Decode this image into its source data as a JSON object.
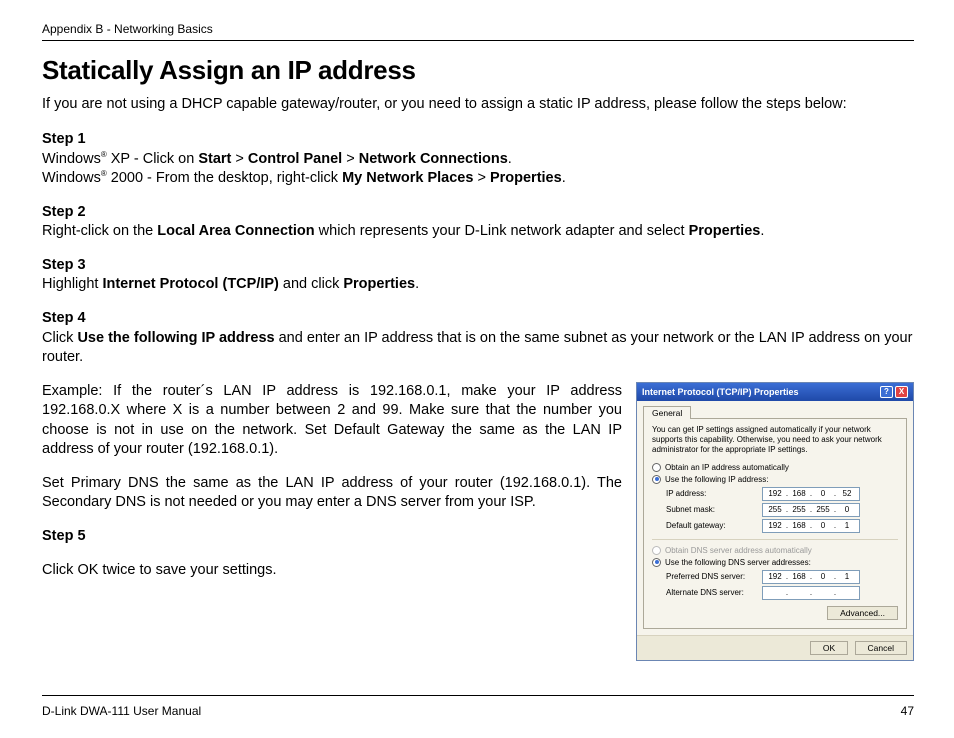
{
  "header": {
    "breadcrumb": "Appendix B - Networking Basics"
  },
  "title": "Statically Assign an IP address",
  "intro": "If you are not using a DHCP capable gateway/router, or you need to assign a static IP address, please follow the steps below:",
  "steps": {
    "s1": {
      "head": "Step 1",
      "xp_prefix": "Windows",
      "xp_reg": "®",
      "xp_os": " XP - Click on ",
      "xp_b1": "Start",
      "xp_sep1": " > ",
      "xp_b2": "Control Panel",
      "xp_sep2": " > ",
      "xp_b3": "Network Connections",
      "xp_end": ".",
      "w2k_prefix": "Windows",
      "w2k_reg": "®",
      "w2k_os": " 2000 - From the desktop, right-click ",
      "w2k_b1": "My Network Places",
      "w2k_sep": " > ",
      "w2k_b2": "Properties",
      "w2k_end": "."
    },
    "s2": {
      "head": "Step 2",
      "t1": "Right-click on the ",
      "b1": "Local Area Connection",
      "t2": " which represents your D-Link network adapter and select ",
      "b2": "Properties",
      "t3": "."
    },
    "s3": {
      "head": "Step 3",
      "t1": "Highlight ",
      "b1": "Internet Protocol (TCP/IP)",
      "t2": " and click ",
      "b2": "Properties",
      "t3": "."
    },
    "s4": {
      "head": "Step 4",
      "t1": "Click ",
      "b1": "Use the following IP address",
      "t2": " and enter an IP address that is on the same subnet as your network or the LAN IP address on your router."
    },
    "example1": "Example: If the router´s LAN IP address is 192.168.0.1, make your IP address 192.168.0.X where X is a number between 2 and 99. Make sure that the number you choose is not in use on the network. Set Default Gateway the same as the LAN IP address of your router (192.168.0.1).",
    "example2": "Set Primary DNS the same as the LAN IP address of your router (192.168.0.1). The Secondary DNS is not needed or you may enter a DNS server from your ISP.",
    "s5": {
      "head": "Step 5",
      "t1": "Click OK twice to save your settings."
    }
  },
  "dialog": {
    "title": "Internet Protocol (TCP/IP) Properties",
    "help_icon": "?",
    "close_icon": "X",
    "tab": "General",
    "desc": "You can get IP settings assigned automatically if your network supports this capability. Otherwise, you need to ask your network administrator for the appropriate IP settings.",
    "radio_auto_ip": "Obtain an IP address automatically",
    "radio_use_ip": "Use the following IP address:",
    "lbl_ip": "IP address:",
    "lbl_subnet": "Subnet mask:",
    "lbl_gateway": "Default gateway:",
    "ip": [
      "192",
      "168",
      "0",
      "52"
    ],
    "subnet": [
      "255",
      "255",
      "255",
      "0"
    ],
    "gateway": [
      "192",
      "168",
      "0",
      "1"
    ],
    "radio_auto_dns": "Obtain DNS server address automatically",
    "radio_use_dns": "Use the following DNS server addresses:",
    "lbl_pdns": "Preferred DNS server:",
    "lbl_adns": "Alternate DNS server:",
    "pdns": [
      "192",
      "168",
      "0",
      "1"
    ],
    "adns": [
      "",
      "",
      "",
      ""
    ],
    "btn_adv": "Advanced...",
    "btn_ok": "OK",
    "btn_cancel": "Cancel"
  },
  "footer": {
    "left": "D-Link DWA-111 User Manual",
    "right": "47"
  }
}
